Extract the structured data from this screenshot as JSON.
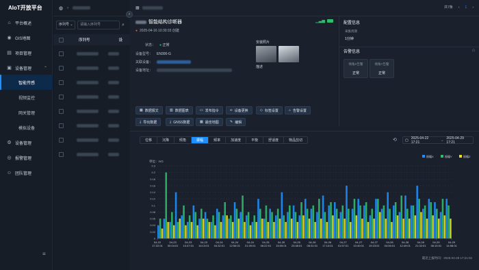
{
  "sidebar": {
    "brand": "AIoT开放平台",
    "items": [
      {
        "label": "平台概述",
        "icon": "home-icon"
      },
      {
        "label": "GIS地图",
        "icon": "map-icon"
      },
      {
        "label": "项目管理",
        "icon": "folder-icon"
      },
      {
        "label": "设备管理",
        "icon": "device-icon"
      },
      {
        "label": "智能传感"
      },
      {
        "label": "视频监控"
      },
      {
        "label": "网关管理"
      },
      {
        "label": "模拟设备"
      },
      {
        "label": "设备管理",
        "icon": "gear-icon"
      },
      {
        "label": "报警管理",
        "icon": "alarm-icon"
      },
      {
        "label": "团队管理",
        "icon": "team-icon"
      }
    ]
  },
  "list": {
    "filter_select": "序列号",
    "search_placeholder": "请输入序列号",
    "col_serial": "序列号",
    "col_name": "设",
    "row_count": 8
  },
  "main": {
    "pager": "共7条",
    "page": "1"
  },
  "device": {
    "title": "智能结构诊断器",
    "created": "2025-04-16 10:30:33 创建",
    "status_label": "状态：",
    "status_value": "正常",
    "model_label": "设备型号：",
    "model_value": "EN300-G",
    "related_label": "关联设备：",
    "address_label": "设备地址：",
    "photos_label": "安装照片",
    "desc_label": "描述"
  },
  "config": {
    "title": "配置信息",
    "period_label": "采集周期",
    "period_value": "1分钟"
  },
  "alarm": {
    "title": "告警信息",
    "x_label": "倾角X告警",
    "x_value": "正常",
    "y_label": "倾角Y告警",
    "y_value": "正常"
  },
  "buttons": [
    "数据报文",
    "数据图表",
    "发布指令",
    "设备更换",
    "标签设置",
    "告警设置",
    "导出数据",
    "GNSS数据",
    "最佳地图",
    "编辑"
  ],
  "tabs": [
    "位移",
    "沉降",
    "倾角",
    "振幅",
    "频率",
    "加速度",
    "平衡",
    "舒适度",
    "物品剪切"
  ],
  "active_tab": "振幅",
  "range": {
    "start": "2025-04-22 17:21",
    "sep": "→",
    "end": "2025-04-29 17:21"
  },
  "footer": "最近上报时间：2025-04-29 17:21:02",
  "colors": {
    "accent": "#1e90ff",
    "x": "#1e90ff",
    "y": "#2ebd6b",
    "z": "#e8e020"
  },
  "chart_data": {
    "type": "bar",
    "ylabel": "单位：mG",
    "ylim": [
      0,
      0.3
    ],
    "yticks": [
      "0",
      "0.02",
      "0.04",
      "0.06",
      "0.08",
      "0.1",
      "0.12",
      "0.14",
      "0.16",
      "0.18",
      "0.2",
      "0.3"
    ],
    "legend": [
      "振幅X",
      "振幅Y",
      "振幅Z"
    ],
    "x_ticks": [
      [
        "04-22",
        "17:22:01"
      ],
      [
        "04-23",
        "00:04:01"
      ],
      [
        "04-23",
        "10:47:01"
      ],
      [
        "04-23",
        "16:13:01"
      ],
      [
        "04-24",
        "04:32:01"
      ],
      [
        "04-24",
        "12:56:01"
      ],
      [
        "04-24",
        "21:39:01"
      ],
      [
        "04-25",
        "06:22:01"
      ],
      [
        "04-25",
        "15:05:01"
      ],
      [
        "04-25",
        "23:48:01"
      ],
      [
        "04-26",
        "08:31:01"
      ],
      [
        "04-26",
        "17:14:01"
      ],
      [
        "04-27",
        "01:57:01"
      ],
      [
        "04-27",
        "10:40:01"
      ],
      [
        "04-27",
        "19:23:01"
      ],
      [
        "04-28",
        "04:06:01"
      ],
      [
        "04-28",
        "12:49:01"
      ],
      [
        "04-28",
        "21:32:01"
      ],
      [
        "04-29",
        "06:15:01"
      ],
      [
        "04-29",
        "14:58:01"
      ]
    ],
    "series": [
      {
        "name": "振幅X",
        "values": [
          0.04,
          0.06,
          0.05,
          0.14,
          0.07,
          0.05,
          0.1,
          0.06,
          0.08,
          0.05,
          0.09,
          0.07,
          0.06,
          0.11,
          0.08,
          0.07,
          0.05,
          0.12,
          0.06,
          0.09,
          0.07,
          0.14,
          0.08,
          0.1,
          0.07,
          0.12,
          0.09,
          0.08,
          0.13,
          0.1,
          0.11,
          0.08,
          0.16,
          0.09,
          0.12,
          0.1,
          0.07,
          0.12,
          0.09,
          0.14,
          0.1,
          0.08,
          0.13,
          0.1,
          0.16,
          0.09,
          0.12,
          0.11,
          0.08,
          0.12
        ]
      },
      {
        "name": "振幅Y",
        "values": [
          0.06,
          0.2,
          0.08,
          0.05,
          0.1,
          0.07,
          0.08,
          0.09,
          0.06,
          0.07,
          0.08,
          0.11,
          0.07,
          0.09,
          0.13,
          0.08,
          0.07,
          0.09,
          0.1,
          0.08,
          0.09,
          0.07,
          0.1,
          0.08,
          0.11,
          0.09,
          0.1,
          0.12,
          0.08,
          0.11,
          0.09,
          0.1,
          0.09,
          0.12,
          0.1,
          0.11,
          0.09,
          0.12,
          0.1,
          0.09,
          0.11,
          0.13,
          0.09,
          0.1,
          0.12,
          0.1,
          0.11,
          0.09,
          0.12,
          0.1
        ]
      },
      {
        "name": "振幅Z",
        "values": [
          0.03,
          0.05,
          0.04,
          0.06,
          0.04,
          0.05,
          0.04,
          0.06,
          0.05,
          0.04,
          0.05,
          0.07,
          0.05,
          0.06,
          0.05,
          0.04,
          0.05,
          0.06,
          0.05,
          0.05,
          0.06,
          0.05,
          0.06,
          0.05,
          0.07,
          0.06,
          0.05,
          0.06,
          0.05,
          0.07,
          0.06,
          0.06,
          0.05,
          0.07,
          0.06,
          0.05,
          0.06,
          0.08,
          0.06,
          0.05,
          0.07,
          0.06,
          0.06,
          0.07,
          0.08,
          0.06,
          0.07,
          0.06,
          0.07,
          0.06
        ]
      }
    ]
  }
}
